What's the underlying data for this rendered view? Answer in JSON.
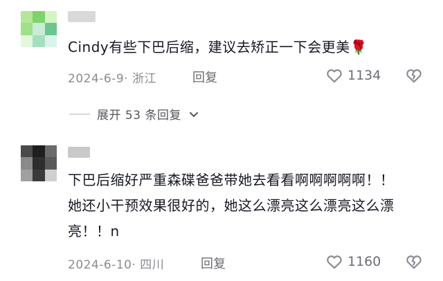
{
  "comments": [
    {
      "text": "Cindy有些下巴后缩，建议去矫正一下会更美🌹",
      "date_location": "2024-6-9· 浙江",
      "reply_label": "回复",
      "like_count": "1134",
      "avatar_colors": [
        "#b7e59a",
        "#7fd36b",
        "#d6f3c4",
        "#9fe08a",
        "#c8ecd6",
        "#6cc58f",
        "#e4f7dc",
        "#a6dfc0",
        "#d9f5ea"
      ],
      "username_color": "#d9d9d9"
    },
    {
      "text": "下巴后缩好严重森碟爸爸带她去看看啊啊啊啊啊！！她还小干预效果很好的，她这么漂亮这么漂亮这么漂亮！！n",
      "date_location": "2024-6-10· 四川",
      "reply_label": "回复",
      "like_count": "1160",
      "avatar_colors": [
        "#4a4a4a",
        "#1f1f1f",
        "#6b6b6b",
        "#8a8a8a",
        "#2e2e2e",
        "#5a5a5a",
        "#a0a0a0",
        "#3a3a3a",
        "#cfcfcf"
      ],
      "username_color": "#c9c9c9"
    }
  ],
  "expand_replies": "展开 53 条回复",
  "icons": {
    "like": "heart-outline-icon",
    "dislike": "broken-heart-icon",
    "expand": "chevron-down-icon"
  }
}
